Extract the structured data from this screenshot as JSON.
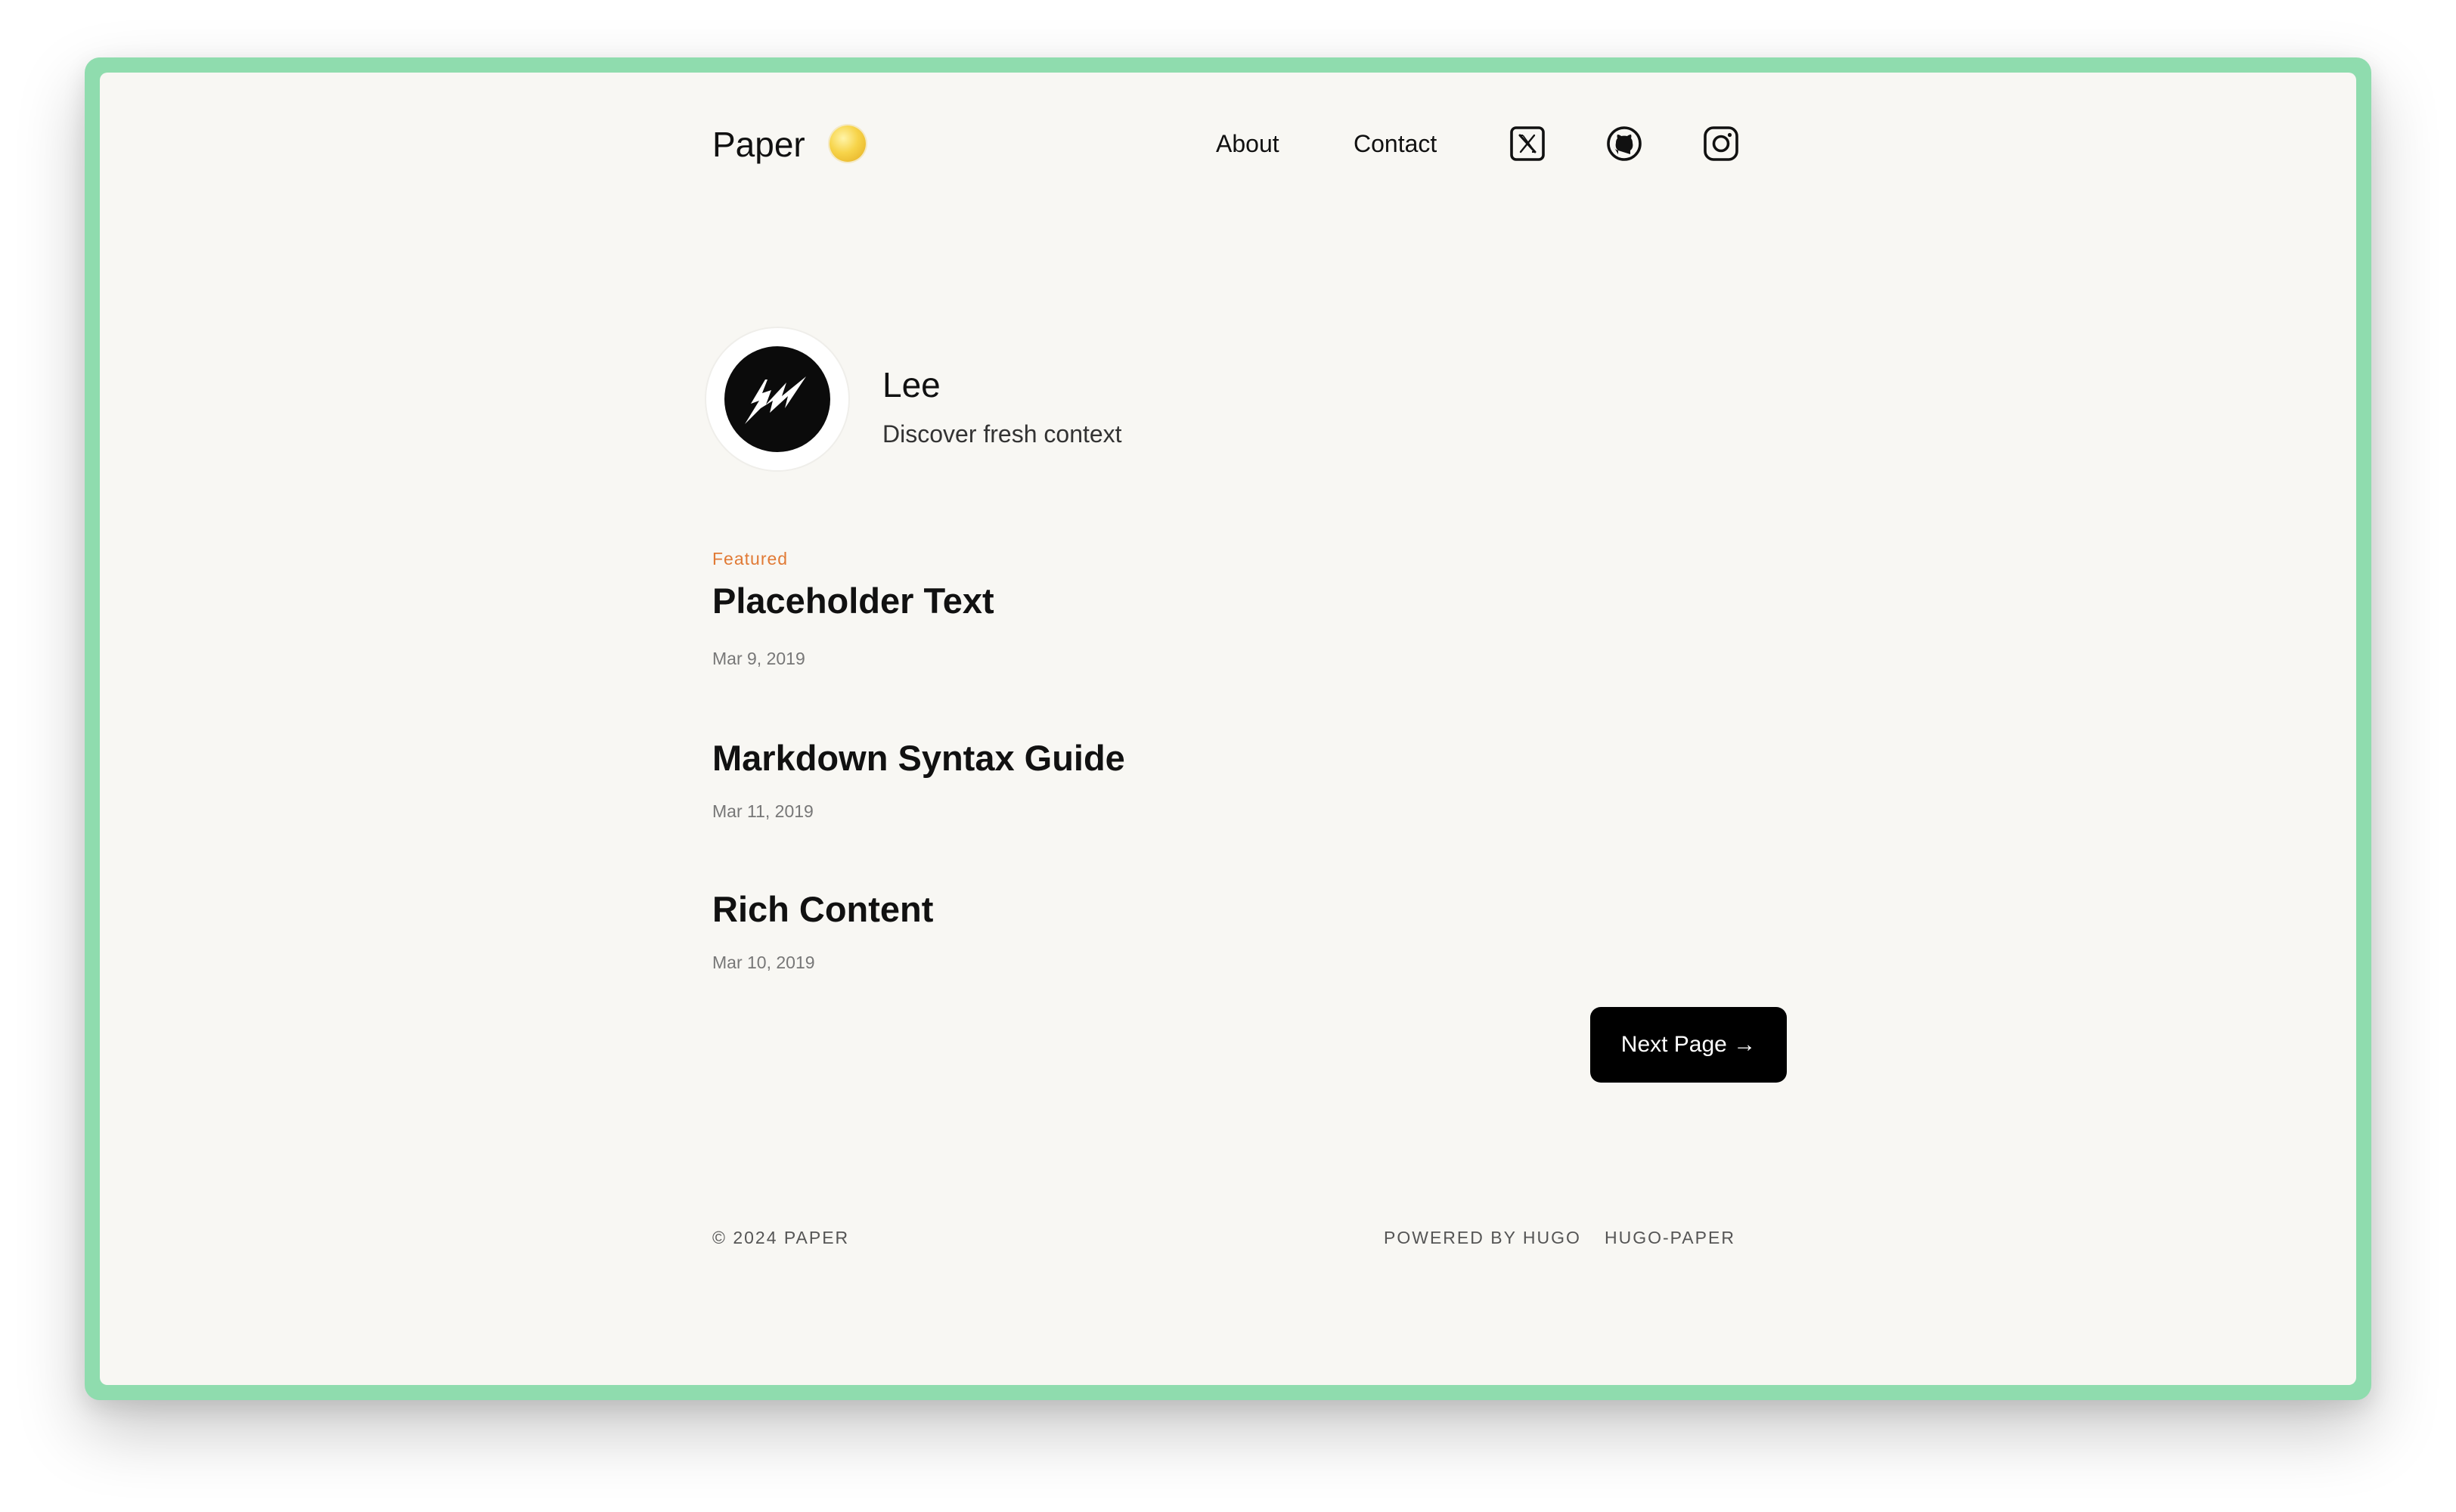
{
  "header": {
    "logo": "Paper",
    "nav": [
      {
        "label": "About"
      },
      {
        "label": "Contact"
      }
    ],
    "social_icons": [
      "x-twitter-icon",
      "github-icon",
      "instagram-icon"
    ],
    "theme_toggle_icon": "sun-icon"
  },
  "profile": {
    "name": "Lee",
    "bio": "Discover fresh context",
    "avatar_icon": "lightning-bolt-avatar"
  },
  "posts": [
    {
      "featured_label": "Featured",
      "title": "Placeholder Text",
      "date": "Mar 9, 2019"
    },
    {
      "title": "Markdown Syntax Guide",
      "date": "Mar 11, 2019"
    },
    {
      "title": "Rich Content",
      "date": "Mar 10, 2019"
    }
  ],
  "pagination": {
    "next_label": "Next Page →"
  },
  "footer": {
    "copyright": "© 2024 PAPER",
    "links": [
      {
        "label": "POWERED BY HUGO"
      },
      {
        "label": "HUGO-PAPER"
      }
    ]
  },
  "colors": {
    "frame_border": "#8fdcae",
    "page_background": "#f8f7f3",
    "featured_accent": "#e17a35",
    "button_background": "#000000",
    "theme_toggle": "#f7d44a"
  }
}
